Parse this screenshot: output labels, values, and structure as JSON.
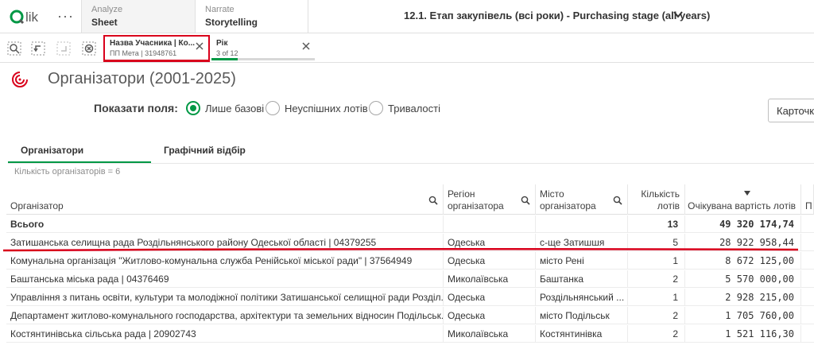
{
  "topbar": {
    "logo_text": "Qlik",
    "more": "···",
    "analyze": {
      "sub": "Analyze",
      "main": "Sheet"
    },
    "narrate": {
      "sub": "Narrate",
      "main": "Storytelling"
    },
    "app_title": "12.1. Етап закупівель (всі роки) - Purchasing stage (all years)"
  },
  "selections": [
    {
      "title": "Назва Учасника | Ко...",
      "value": "ПП Мета | 31948761"
    },
    {
      "title": "Рік",
      "value": "3 of 12",
      "fraction": 0.25
    }
  ],
  "sheet": {
    "title": "Організатори (2001-2025)"
  },
  "fields": {
    "label": "Показати поля:",
    "options": [
      {
        "label": "Лише базові",
        "selected": true
      },
      {
        "label": "Неуспішних лотів",
        "selected": false
      },
      {
        "label": "Тривалості",
        "selected": false
      }
    ],
    "cards_button": "Карточк"
  },
  "tabs": [
    {
      "label": "Організатори",
      "active": true
    },
    {
      "label": "Графічний відбір",
      "active": false
    }
  ],
  "count_text": "Кількість організаторів = 6",
  "table": {
    "headers": {
      "org": "Організатор",
      "region_1": "Регіон",
      "region_2": "організатора",
      "city_1": "Місто",
      "city_2": "організатора",
      "count_1": "Кількість",
      "count_2": "лотів",
      "value": "Очікувана вартість лотів",
      "extra": "П"
    },
    "total": {
      "label": "Всього",
      "count": "13",
      "value": "49 320 174,74"
    },
    "rows": [
      {
        "org": "Затишанська селищна рада Роздільнянського району Одеської області | 04379255",
        "region": "Одеська",
        "city": "с-ще Затишшя",
        "count": "5",
        "value": "28 922 958,44"
      },
      {
        "org": "Комунальна організація \"Житлово-комунальна служба Ренійської міської ради\" | 37564949",
        "region": "Одеська",
        "city": "місто Рені",
        "count": "1",
        "value": "8 672 125,00"
      },
      {
        "org": "Баштанська міська рада | 04376469",
        "region": "Миколаївська",
        "city": "Баштанка",
        "count": "2",
        "value": "5 570 000,00"
      },
      {
        "org": "Управління з питань освіти, культури та молодіжної політики Затишанської селищної ради Розділ...",
        "region": "Одеська",
        "city": "Роздільнянський ...",
        "count": "1",
        "value": "2 928 215,00"
      },
      {
        "org": "Департамент житлово-комунального господарства, архітектури та земельних відносин Подільськ...",
        "region": "Одеська",
        "city": "місто Подільськ",
        "count": "2",
        "value": "1 705 760,00"
      },
      {
        "org": "Костянтинівська сільська рада | 20902743",
        "region": "Миколаївська",
        "city": "Костянтинівка",
        "count": "2",
        "value": "1 521 116,30"
      }
    ]
  },
  "colors": {
    "accent": "#009845",
    "highlight": "#d9001b"
  }
}
